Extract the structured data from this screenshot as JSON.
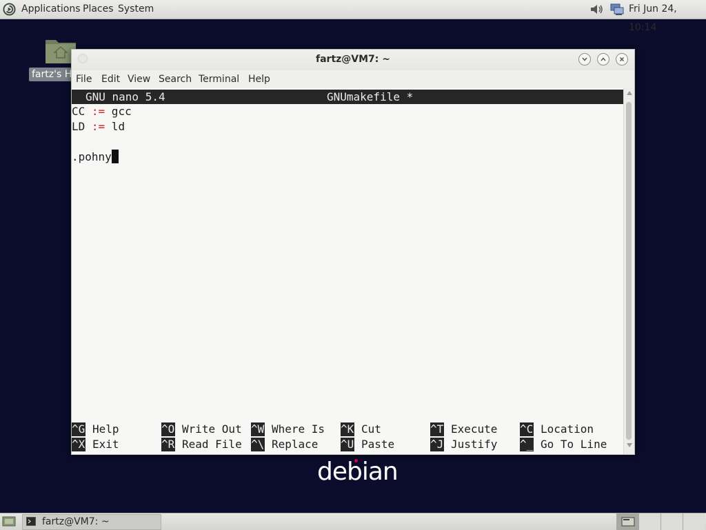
{
  "top_panel": {
    "menus": [
      "Applications",
      "Places",
      "System"
    ],
    "clock": "Fri Jun 24, 10:14"
  },
  "desktop": {
    "home_label": "fartz's Home",
    "logo_text": "debian"
  },
  "window": {
    "title": "fartz@VM7: ~",
    "menus": [
      "File",
      "Edit",
      "View",
      "Search",
      "Terminal",
      "Help"
    ]
  },
  "nano": {
    "version": "GNU nano 5.4",
    "filename": "GNUmakefile *",
    "lines": [
      {
        "name": "CC ",
        "op": ":=",
        "value": " gcc"
      },
      {
        "name": "LD ",
        "op": ":=",
        "value": " ld"
      },
      {
        "text": ".pohny"
      }
    ],
    "shortcuts_row1": [
      {
        "key": "^G",
        "label": "Help"
      },
      {
        "key": "^O",
        "label": "Write Out"
      },
      {
        "key": "^W",
        "label": "Where Is"
      },
      {
        "key": "^K",
        "label": "Cut"
      },
      {
        "key": "^T",
        "label": "Execute"
      },
      {
        "key": "^C",
        "label": "Location"
      }
    ],
    "shortcuts_row2": [
      {
        "key": "^X",
        "label": "Exit"
      },
      {
        "key": "^R",
        "label": "Read File"
      },
      {
        "key": "^\\",
        "label": "Replace"
      },
      {
        "key": "^U",
        "label": "Paste"
      },
      {
        "key": "^J",
        "label": "Justify"
      },
      {
        "key": "^_",
        "label": "Go To Line"
      }
    ]
  },
  "taskbar": {
    "task_label": "fartz@VM7: ~"
  },
  "colors": {
    "desktop_bg": "#0c0c2c",
    "nano_bar": "#262626",
    "syntax_operator": "#cc1f1f"
  },
  "icons": [
    "debian-swirl-icon",
    "volume-icon",
    "network-icon",
    "home-folder-icon",
    "terminal-icon",
    "show-desktop-icon"
  ]
}
